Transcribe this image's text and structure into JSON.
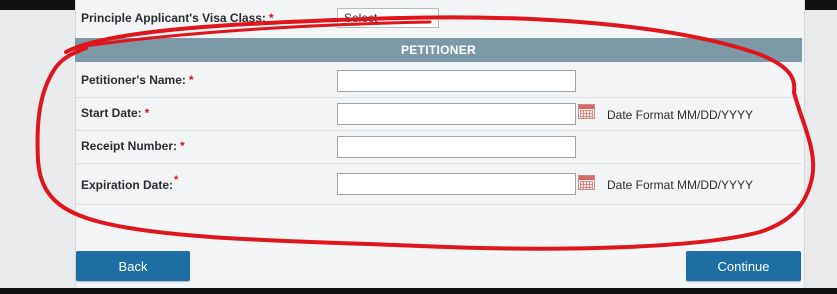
{
  "previous_field": {
    "label": "Principle Applicant's Visa Class:",
    "select_value": "Select"
  },
  "section": {
    "title": "PETITIONER"
  },
  "fields": [
    {
      "label": "Petitioner's Name:",
      "required_mark": "*"
    },
    {
      "label": "Start Date:",
      "required_mark": "*",
      "hint": "Date Format MM/DD/YYYY"
    },
    {
      "label": "Receipt Number:",
      "required_mark": "*"
    },
    {
      "label": "Expiration Date:",
      "required_mark": "*",
      "hint": "Date Format MM/DD/YYYY"
    }
  ],
  "buttons": {
    "back": "Back",
    "continue": "Continue"
  },
  "colors": {
    "header": "#7d99a6",
    "button": "#1c6ea4",
    "required": "#d0141b",
    "annotation": "#e0141c"
  },
  "icons": [
    "calendar-icon"
  ]
}
